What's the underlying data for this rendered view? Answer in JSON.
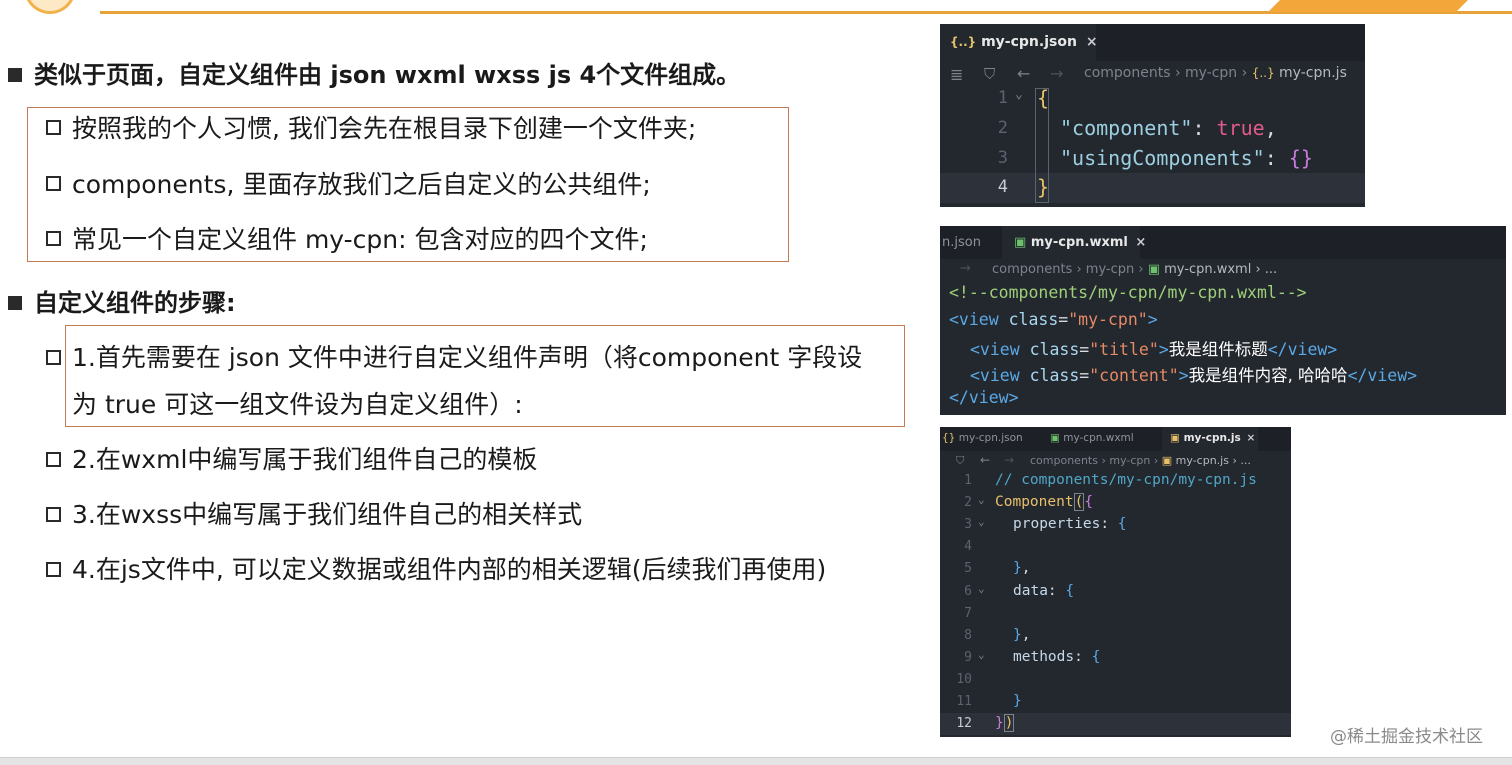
{
  "slide": {
    "bullet1": "类似于页面，自定义组件由 json wxml wxss js 4个文件组成。",
    "sub1": [
      "按照我的个人习惯, 我们会先在根目录下创建一个文件夹;",
      "components, 里面存放我们之后自定义的公共组件;",
      "常见一个自定义组件 my-cpn: 包含对应的四个文件;"
    ],
    "bullet2": "自定义组件的步骤:",
    "step1_line1": "1.首先需要在 json 文件中进行自定义组件声明（将component 字段设",
    "step1_line2": "为 true 可这一组文件设为自定义组件）:",
    "step2": "2.在wxml中编写属于我们组件自己的模板",
    "step3": "3.在wxss中编写属于我们组件自己的相关样式",
    "step4": "4.在js文件中, 可以定义数据或组件内部的相关逻辑(后续我们再使用)"
  },
  "json_panel": {
    "tab": "my-cpn.json",
    "tab_icon": "{..}",
    "close": "×",
    "breadcrumb": "components › my-cpn › ",
    "breadcrumb_file": "my-cpn.js",
    "line_numbers": [
      "1",
      "2",
      "3",
      "4"
    ],
    "brace_open": "{",
    "key1": "\"component\"",
    "val1": "true",
    "key2": "\"usingComponents\"",
    "val2": "{}",
    "brace_close": "}"
  },
  "wxml_panel": {
    "tab_prev": "n.json",
    "tab": "my-cpn.wxml",
    "close": "×",
    "breadcrumb": "components › my-cpn › ",
    "breadcrumb_file": "my-cpn.wxml › ...",
    "comment": "<!--components/my-cpn/my-cpn.wxml-->",
    "class_root": "\"my-cpn\"",
    "class_title": "\"title\"",
    "text_title": "我是组件标题",
    "class_content": "\"content\"",
    "text_content": "我是组件内容, 哈哈哈"
  },
  "js_panel": {
    "tabs": [
      "my-cpn.json",
      "my-cpn.wxml",
      "my-cpn.js"
    ],
    "close": "×",
    "breadcrumb": "components › my-cpn › ",
    "breadcrumb_file": "my-cpn.js › ...",
    "line_numbers": [
      "1",
      "2",
      "3",
      "4",
      "5",
      "6",
      "7",
      "8",
      "9",
      "10",
      "11",
      "12"
    ],
    "comment": "// components/my-cpn/my-cpn.js",
    "fn": "Component",
    "prop1": "properties",
    "prop2": "data",
    "prop3": "methods"
  },
  "watermark": "@稀土掘金技术社区"
}
